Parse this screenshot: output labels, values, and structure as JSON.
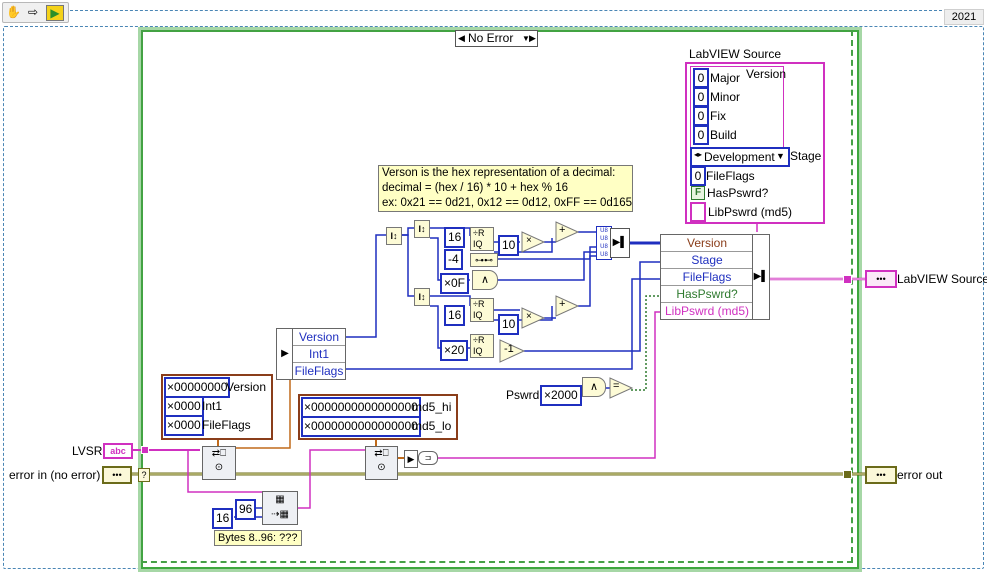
{
  "toolbar": {
    "icons": [
      "hand-icon",
      "arrow-icon",
      "run-icon"
    ]
  },
  "version_badge": "2021",
  "case_selector": {
    "value": "No Error"
  },
  "source_cluster": {
    "title": "LabVIEW Source",
    "inner_label": "Version",
    "version_fields": [
      {
        "value": "0",
        "label": "Major"
      },
      {
        "value": "0",
        "label": "Minor"
      },
      {
        "value": "0",
        "label": "Fix"
      },
      {
        "value": "0",
        "label": "Build"
      }
    ],
    "stage_value": "Development",
    "stage_label": "Stage",
    "fileflags_value": "0",
    "fileflags_label": "FileFlags",
    "haspswrd_glyph": "F",
    "haspswrd_label": "HasPswrd?",
    "libpswrd_label": "LibPswrd (md5)"
  },
  "comment": {
    "line1": "Verson is the hex representation of a decimal:",
    "line2": "decimal = (hex / 16) * 10 + hex % 16",
    "line3": "ex: 0x21 == 0d21, 0x12 == 0d12, 0xFF == 0d165"
  },
  "constants": {
    "c16a": "16",
    "cneg4": "-4",
    "c0F": "×0F",
    "c16b": "16",
    "c20": "×20",
    "c10a": "10",
    "c10b": "10",
    "pswrd": "×2000",
    "c96": "96",
    "c16c": "16"
  },
  "bundle_right": {
    "rows": [
      "Version",
      "Stage",
      "FileFlags",
      "HasPswrd?",
      "LibPswrd (md5)"
    ],
    "colors": [
      "#8a3d1a",
      "#1f2fbf",
      "#1f2fbf",
      "#2f7a2f",
      "#d030c0"
    ]
  },
  "unbundle_left": {
    "rows": [
      "Version",
      "Int1",
      "FileFlags"
    ]
  },
  "struct1": {
    "fields": [
      {
        "value": "×00000000",
        "label": "Version"
      },
      {
        "value": "×0000",
        "label": "Int1"
      },
      {
        "value": "×0000",
        "label": "FileFlags"
      }
    ]
  },
  "struct2": {
    "fields": [
      {
        "value": "×0000000000000000",
        "label": "md5_hi"
      },
      {
        "value": "×0000000000000000",
        "label": "md5_lo"
      }
    ]
  },
  "labels": {
    "pswrd": "Pswrd",
    "lvsr": "LVSR",
    "error_in": "error in (no error)",
    "error_out": "error out",
    "labview_source_out": "LabVIEW Source",
    "bytes_note": "Bytes 8..96: ???"
  },
  "terminals": {
    "lvsr_glyph": "abc",
    "err_glyph": "•••",
    "cluster_glyph": "•••"
  },
  "colors": {
    "case_green": "#3fa73f",
    "wire_pink": "#d030c0",
    "wire_blue": "#1f2fbf",
    "wire_olive": "#6b6b1a",
    "wire_orange": "#c06a1a"
  }
}
